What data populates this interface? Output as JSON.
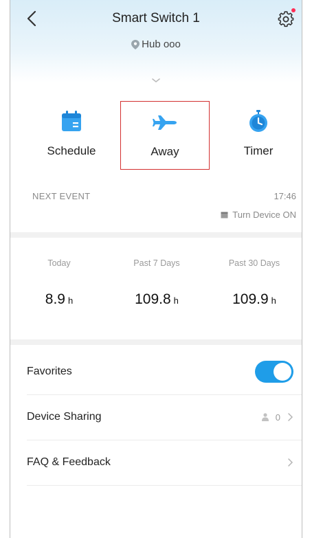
{
  "header": {
    "title": "Smart Switch 1",
    "location": "Hub ooo"
  },
  "modes": [
    {
      "label": "Schedule",
      "icon": "calendar-icon",
      "selected": false
    },
    {
      "label": "Away",
      "icon": "airplane-icon",
      "selected": true
    },
    {
      "label": "Timer",
      "icon": "stopwatch-icon",
      "selected": false
    }
  ],
  "next_event": {
    "label": "NEXT EVENT",
    "time": "17:46",
    "action": "Turn Device ON"
  },
  "stats": [
    {
      "label": "Today",
      "value": "8.9",
      "unit": "h"
    },
    {
      "label": "Past 7 Days",
      "value": "109.8",
      "unit": "h"
    },
    {
      "label": "Past 30 Days",
      "value": "109.9",
      "unit": "h"
    }
  ],
  "settings": {
    "favorites_label": "Favorites",
    "favorites_on": true,
    "sharing_label": "Device Sharing",
    "sharing_count": "0",
    "faq_label": "FAQ & Feedback"
  },
  "colors": {
    "accent": "#1f9de8",
    "highlight_border": "#d32f2f",
    "notification_dot": "#ff2d55"
  }
}
